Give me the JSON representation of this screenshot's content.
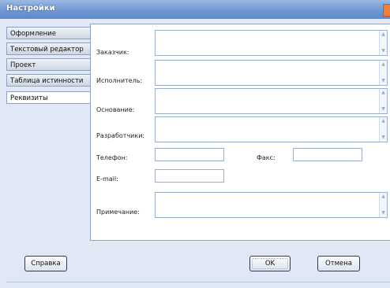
{
  "window": {
    "title": "Настройки"
  },
  "tabs": [
    {
      "label": "Оформление",
      "active": false
    },
    {
      "label": "Текстовый редактор",
      "active": false
    },
    {
      "label": "Проект",
      "active": false
    },
    {
      "label": "Таблица истинности",
      "active": false
    },
    {
      "label": "Реквизиты",
      "active": true
    }
  ],
  "fields": {
    "customer": {
      "label": "Заказчик:",
      "value": ""
    },
    "executor": {
      "label": "Исполнитель:",
      "value": ""
    },
    "basis": {
      "label": "Основание:",
      "value": ""
    },
    "developers": {
      "label": "Разработчики:",
      "value": ""
    },
    "phone": {
      "label": "Телефон:",
      "value": ""
    },
    "fax": {
      "label": "Факс:",
      "value": ""
    },
    "email": {
      "label": "E-mail:",
      "value": ""
    },
    "note": {
      "label": "Примечание:",
      "value": ""
    }
  },
  "buttons": {
    "help": "Справка",
    "ok": "OK",
    "cancel": "Отмена"
  }
}
